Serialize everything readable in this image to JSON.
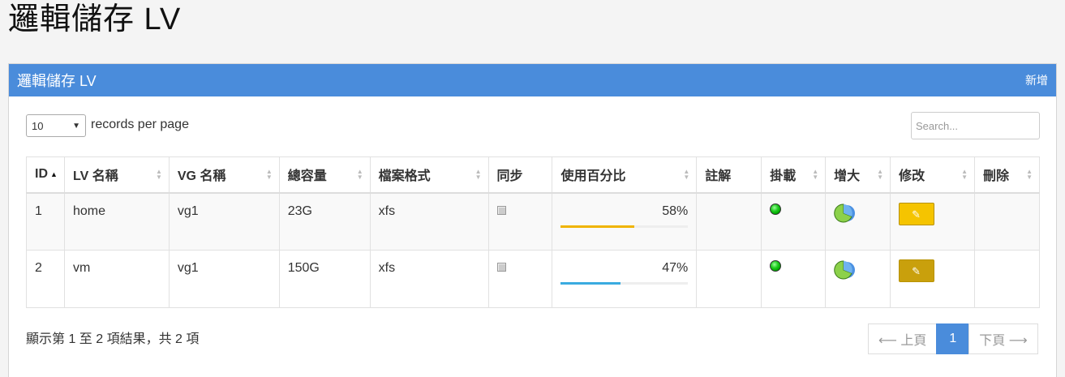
{
  "page_title": "邏輯儲存 LV",
  "panel": {
    "title": "邏輯儲存 LV",
    "add_label": "新增"
  },
  "length_menu": {
    "value": "10",
    "label": "records per page"
  },
  "search": {
    "placeholder": "Search..."
  },
  "table": {
    "columns": [
      "ID",
      "LV 名稱",
      "VG 名稱",
      "總容量",
      "檔案格式",
      "同步",
      "使用百分比",
      "註解",
      "掛載",
      "增大",
      "修改",
      "刪除"
    ],
    "sorted_column": "ID",
    "rows": [
      {
        "id": "1",
        "lv": "home",
        "vg": "vg1",
        "size": "23G",
        "fs": "xfs",
        "usage": "58%",
        "usage_value": 0.58,
        "usage_color": "#f0b400",
        "edit_color": "#f5c400"
      },
      {
        "id": "2",
        "lv": "vm",
        "vg": "vg1",
        "size": "150G",
        "fs": "xfs",
        "usage": "47%",
        "usage_value": 0.47,
        "usage_color": "#3aabe0",
        "edit_color": "#c9a00c"
      }
    ]
  },
  "info": "顯示第 1 至 2 項結果，共 2 項",
  "pagination": {
    "prev": "⟵ 上頁",
    "current": "1",
    "next": "下頁 ⟶"
  },
  "colors": {
    "header_blue": "#4a8cdb",
    "mount_green": "#22aa22"
  }
}
